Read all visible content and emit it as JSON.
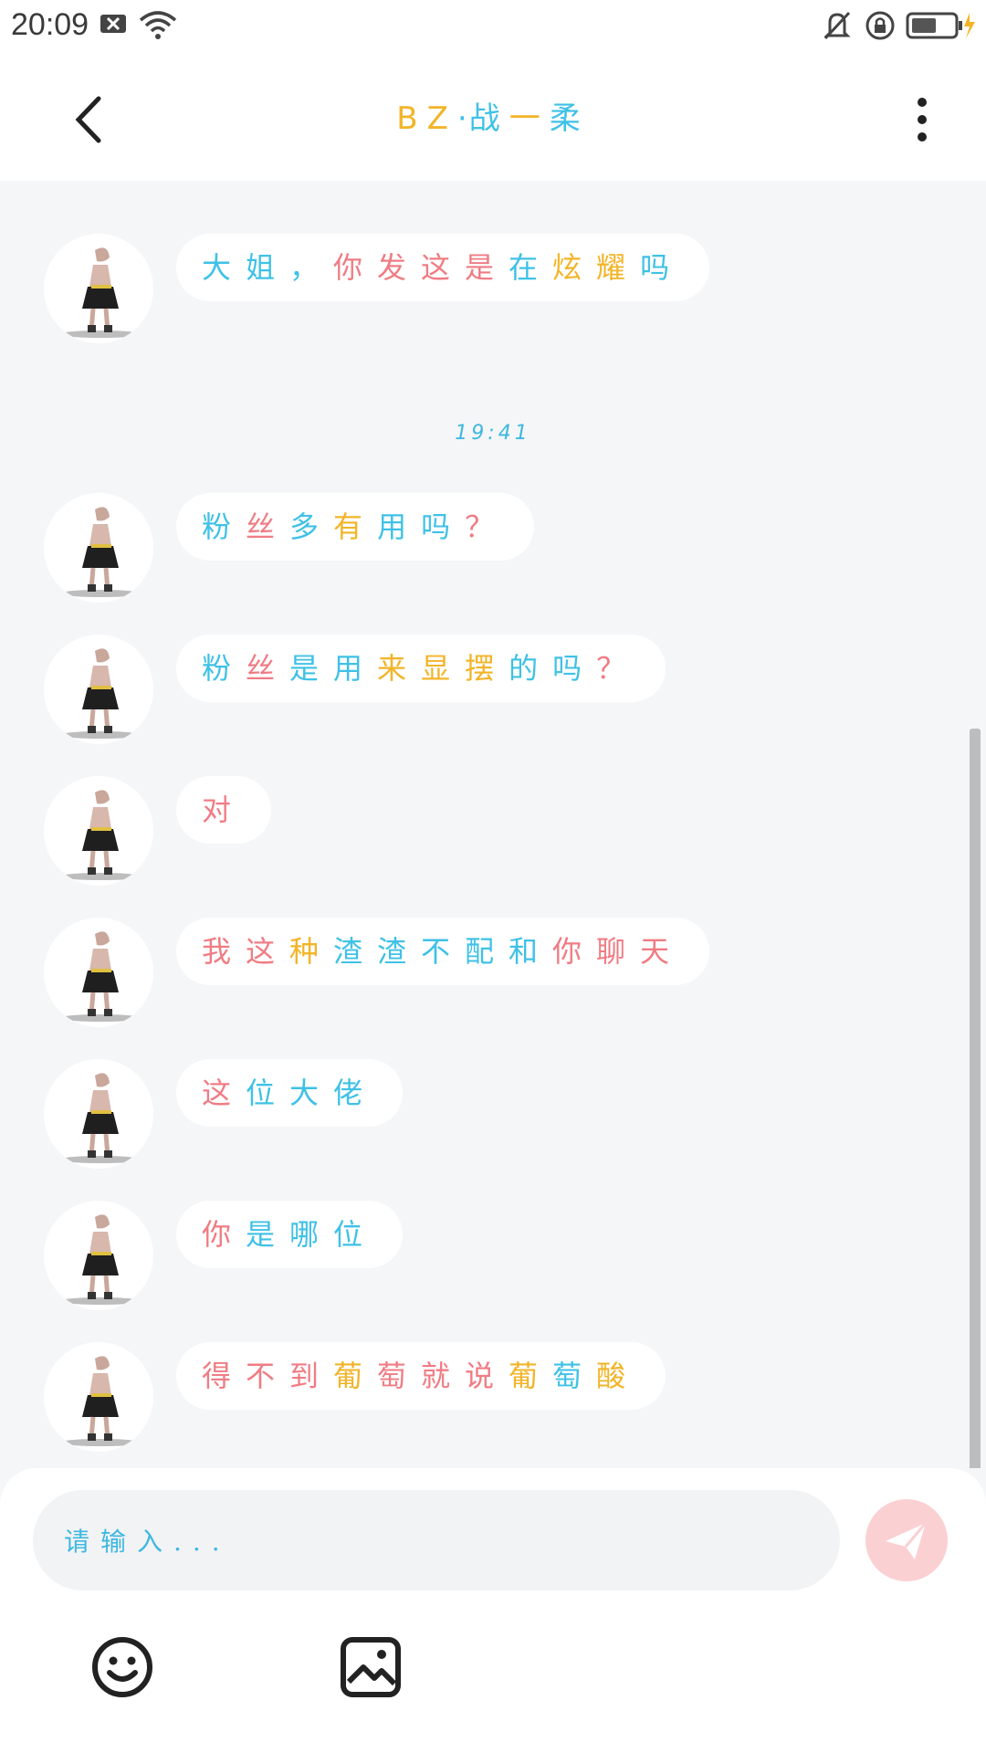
{
  "status_bar": {
    "time": "20:09",
    "icons": [
      "close-box-icon",
      "wifi-icon",
      "bell-off-icon",
      "lock-rotation-icon",
      "battery-charging-icon"
    ]
  },
  "header": {
    "title_parts": [
      {
        "text": "BZ",
        "color": "#f2b428"
      },
      {
        "text": "·",
        "color": "#3fc1e6"
      },
      {
        "text": "战",
        "color": "#3fc1e6"
      },
      {
        "text": "一",
        "color": "#f2b428"
      },
      {
        "text": "柔",
        "color": "#3fc1e6"
      }
    ],
    "back_icon": "chevron-left-icon",
    "more_icon": "more-vertical-icon"
  },
  "chat": {
    "timestamps": [
      "19:41"
    ],
    "messages": [
      {
        "segments": [
          {
            "t": "大姐，",
            "c": "blue"
          },
          {
            "t": "你发这是",
            "c": "pink"
          },
          {
            "t": "在",
            "c": "blue"
          },
          {
            "t": "炫耀",
            "c": "yellow"
          },
          {
            "t": "吗",
            "c": "blue"
          }
        ]
      },
      {
        "segments": [
          {
            "t": "粉",
            "c": "blue"
          },
          {
            "t": "丝",
            "c": "pink"
          },
          {
            "t": "多",
            "c": "blue"
          },
          {
            "t": "有",
            "c": "yellow"
          },
          {
            "t": "用吗",
            "c": "blue"
          },
          {
            "t": "？",
            "c": "pink"
          }
        ]
      },
      {
        "segments": [
          {
            "t": "粉",
            "c": "blue"
          },
          {
            "t": "丝",
            "c": "pink"
          },
          {
            "t": "是用",
            "c": "blue"
          },
          {
            "t": "来显摆",
            "c": "yellow"
          },
          {
            "t": "的吗",
            "c": "blue"
          },
          {
            "t": "？",
            "c": "pink"
          }
        ]
      },
      {
        "segments": [
          {
            "t": "对",
            "c": "pink"
          }
        ]
      },
      {
        "segments": [
          {
            "t": "我这",
            "c": "pink"
          },
          {
            "t": "种",
            "c": "yellow"
          },
          {
            "t": "渣渣不配和",
            "c": "blue"
          },
          {
            "t": "你聊天",
            "c": "pink"
          }
        ]
      },
      {
        "segments": [
          {
            "t": "这",
            "c": "pink"
          },
          {
            "t": "位大佬",
            "c": "blue"
          }
        ]
      },
      {
        "segments": [
          {
            "t": "你",
            "c": "pink"
          },
          {
            "t": "是哪位",
            "c": "blue"
          }
        ]
      },
      {
        "segments": [
          {
            "t": "得不到",
            "c": "pink"
          },
          {
            "t": "葡",
            "c": "yellow"
          },
          {
            "t": "萄就说",
            "c": "pink"
          },
          {
            "t": "葡",
            "c": "yellow"
          },
          {
            "t": "萄",
            "c": "blue"
          },
          {
            "t": "酸",
            "c": "yellow"
          }
        ]
      }
    ]
  },
  "composer": {
    "placeholder": "请输入...",
    "send_icon": "send-icon",
    "tools": [
      "emoji-icon",
      "image-icon"
    ]
  },
  "colors": {
    "blue": "#3fc1e6",
    "pink": "#f07c84",
    "yellow": "#f2b428",
    "background": "#f5f6f8"
  }
}
